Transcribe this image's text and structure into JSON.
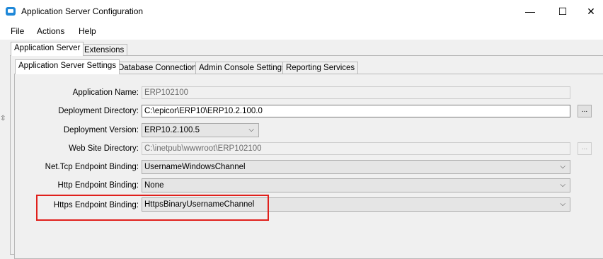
{
  "window": {
    "title": "Application Server Configuration",
    "controls": {
      "minimize": "—",
      "maximize": "☐",
      "close": "✕"
    }
  },
  "menu": [
    "File",
    "Actions",
    "Help"
  ],
  "outer_tabs": [
    {
      "label": "Application Server",
      "active": true
    },
    {
      "label": "Extensions",
      "active": false
    }
  ],
  "inner_tabs": [
    {
      "label": "Application Server Settings",
      "active": true
    },
    {
      "label": "Database Connection",
      "active": false
    },
    {
      "label": "Admin Console Settings",
      "active": false
    },
    {
      "label": "Reporting Services",
      "active": false
    }
  ],
  "form": {
    "application_name": {
      "label": "Application Name:",
      "value": "ERP102100",
      "readonly": true
    },
    "deployment_directory": {
      "label": "Deployment Directory:",
      "value": "C:\\epicor\\ERP10\\ERP10.2.100.0",
      "browse": "..."
    },
    "deployment_version": {
      "label": "Deployment Version:",
      "value": "ERP10.2.100.5"
    },
    "web_site_directory": {
      "label": "Web Site Directory:",
      "value": "C:\\inetpub\\wwwroot\\ERP102100",
      "readonly": true,
      "browse": "..."
    },
    "net_tcp_binding": {
      "label": "Net.Tcp Endpoint Binding:",
      "value": "UsernameWindowsChannel"
    },
    "http_binding": {
      "label": "Http Endpoint Binding:",
      "value": "None"
    },
    "https_binding": {
      "label": "Https Endpoint Binding:",
      "value": "HttpsBinaryUsernameChannel"
    }
  },
  "colors": {
    "highlight_box": "#e0201c",
    "app_icon": "#1f88d8"
  }
}
